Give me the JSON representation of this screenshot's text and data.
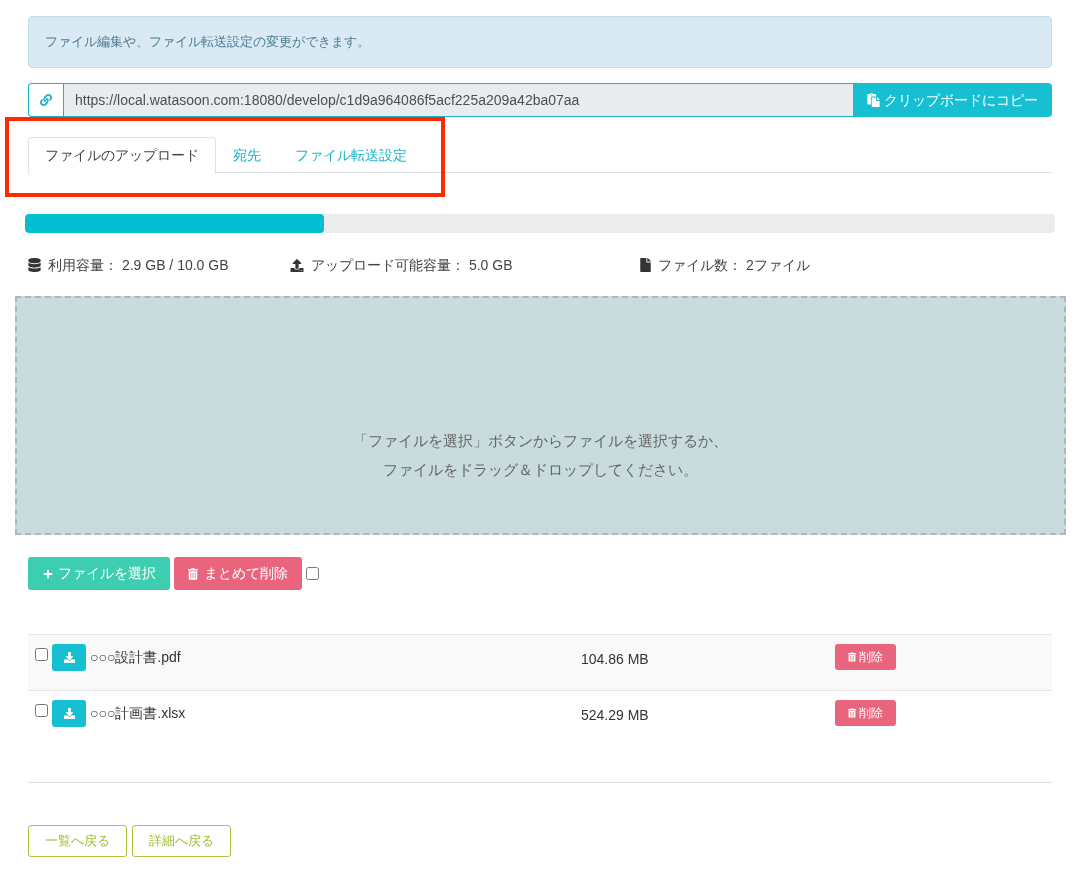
{
  "notice": {
    "text": "ファイル編集や、ファイル転送設定の変更ができます。"
  },
  "share_link": {
    "value": "https://local.watasoon.com:18080/develop/c1d9a964086f5acf225a209a42ba07aa",
    "copy_button": "クリップボードにコピー"
  },
  "tabs": [
    {
      "label": "ファイルのアップロード",
      "selected": true
    },
    {
      "label": "宛先",
      "selected": false
    },
    {
      "label": "ファイル転送設定",
      "selected": false
    }
  ],
  "storage_bar": {
    "level": 0.29
  },
  "stats": [
    {
      "kind": "used",
      "text": "利用容量： 2.9 GB / 10.0 GB"
    },
    {
      "kind": "available",
      "text": "アップロード可能容量： 5.0 GB"
    },
    {
      "kind": "count",
      "text": "ファイル数： 2ファイル"
    }
  ],
  "dropzone": {
    "lines": [
      "「ファイルを選択」ボタンからファイルを選択するか、",
      "ファイルをドラッグ＆ドロップしてください。"
    ]
  },
  "actions": {
    "select_button": "ファイルを選択",
    "bulk_delete_button": "まとめて削除",
    "select_all_checked": false
  },
  "files": [
    {
      "name": "○○○設計書.pdf",
      "size": "104.86 MB",
      "checked": false,
      "delete_button": "削除"
    },
    {
      "name": "○○○計画書.xlsx",
      "size": "524.29 MB",
      "checked": false,
      "delete_button": "削除"
    }
  ],
  "footer_buttons": [
    "一覧へ戻る",
    "詳細へ戻る"
  ]
}
